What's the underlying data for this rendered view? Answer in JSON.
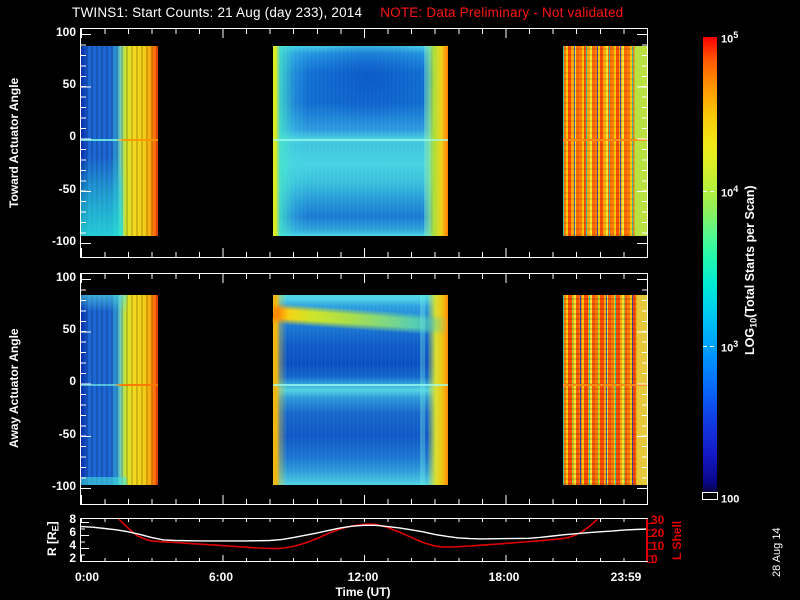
{
  "title": {
    "text": "TWINS1: Start Counts: 21 Aug (day 233), 2014",
    "note": "NOTE: Data Preliminary - Not validated"
  },
  "colors": {
    "note_red": "#ff1515",
    "axis_white": "#ffffff",
    "l_shell_red": "#e00000",
    "background": "#000000"
  },
  "panels": {
    "toward": {
      "ylabel": "Toward Actuator Angle",
      "yticks": [
        "100",
        "50",
        "0",
        "-50",
        "-100"
      ]
    },
    "away": {
      "ylabel": "Away Actuator Angle",
      "yticks": [
        "100",
        "50",
        "0",
        "-50",
        "-100"
      ]
    },
    "orbit": {
      "ylabel_left_pre": "R [R",
      "ylabel_left_sub": "E",
      "ylabel_left_post": "]",
      "left_ticks": [
        "8",
        "6",
        "4",
        "2"
      ],
      "ylabel_right": "L Shell",
      "right_ticks": [
        "30",
        "20",
        "10",
        "0"
      ]
    }
  },
  "xaxis": {
    "label": "Time (UT)",
    "ticks": [
      "0:00",
      "6:00",
      "12:00",
      "18:00",
      "23:59"
    ]
  },
  "colorbar": {
    "label_pre": "LOG",
    "label_sub": "10",
    "label_post": "(Total Starts per Scan)",
    "ticks": [
      {
        "b": "10",
        "s": "5"
      },
      {
        "b": "10",
        "s": "4"
      },
      {
        "b": "10",
        "s": "3"
      },
      {
        "b": "100",
        "s": ""
      }
    ]
  },
  "datestamp": "28 Aug 14",
  "chart_data": [
    {
      "type": "heatmap",
      "panel": "toward",
      "ylabel": "Toward Actuator Angle",
      "xlim_hours": [
        0,
        24
      ],
      "ylim": [
        -100,
        100
      ],
      "value_label": "LOG10(Total Starts per Scan)",
      "value_scale": "log",
      "value_range": [
        100,
        100000
      ],
      "segments": [
        {
          "start_hour": 0.0,
          "end_hour": 3.3,
          "description": "blue striated columns on left half, yellow-orange stripes on right half, cyan region below -40 deg on left, orange horizontal line at 0 deg"
        },
        {
          "start_hour": 8.1,
          "end_hour": 15.6,
          "description": "smooth blue field, darkest near top center, cyan lower half, thin bright cyan line at 0 deg, yellow-green then orange column at right edge, cyan-yellow sliver at left edge"
        },
        {
          "start_hour": 20.4,
          "end_hour": 24.0,
          "description": "noisy orange/red/yellow vertical stripes with scattered cyan and dark-blue pixels, smooth yellow-green band at far right, orange line at 0 deg"
        }
      ],
      "gaps_hours": [
        [
          3.3,
          8.1
        ],
        [
          15.6,
          20.4
        ]
      ]
    },
    {
      "type": "heatmap",
      "panel": "away",
      "ylabel": "Away Actuator Angle",
      "xlim_hours": [
        0,
        24
      ],
      "ylim": [
        -100,
        100
      ],
      "value_label": "LOG10(Total Starts per Scan)",
      "value_scale": "log",
      "value_range": [
        100,
        100000
      ],
      "segments": [
        {
          "start_hour": 0.0,
          "end_hour": 3.3,
          "description": "blue striated left half, yellow-orange right half, cyan band at top edge, orange horizontal line at 0 deg"
        },
        {
          "start_hour": 8.1,
          "end_hour": 15.6,
          "description": "bright yellow-orange arc near +75 deg (brightest at left, fading rightward to green then cyan, sloping slightly down), dark blue body, light cyan line at 0 deg, yellow columns at both edges"
        },
        {
          "start_hour": 20.4,
          "end_hour": 24.0,
          "description": "noisy orange/red/yellow vertical stripes with cyan, green and dark-blue speckles, smoother yellow band at right edge"
        }
      ],
      "gaps_hours": [
        [
          3.3,
          8.1
        ],
        [
          15.6,
          20.4
        ]
      ]
    },
    {
      "type": "line",
      "panel": "orbit",
      "x_unit": "hours UT",
      "series": [
        {
          "name": "R [RE]",
          "color": "#ffffff",
          "axis": "left",
          "ylim": [
            2,
            8
          ],
          "points": [
            [
              0,
              7.3
            ],
            [
              0.5,
              7.2
            ],
            [
              1,
              7.0
            ],
            [
              1.5,
              6.8
            ],
            [
              2,
              6.5
            ],
            [
              2.5,
              6.1
            ],
            [
              3,
              5.6
            ],
            [
              3.5,
              5.25
            ],
            [
              4,
              5.15
            ],
            [
              5,
              5.1
            ],
            [
              6,
              5.1
            ],
            [
              7,
              5.1
            ],
            [
              8,
              5.15
            ],
            [
              8.5,
              5.3
            ],
            [
              9,
              5.6
            ],
            [
              9.5,
              5.95
            ],
            [
              10,
              6.3
            ],
            [
              10.5,
              6.7
            ],
            [
              11,
              7.1
            ],
            [
              11.5,
              7.35
            ],
            [
              12,
              7.5
            ],
            [
              12.5,
              7.5
            ],
            [
              13,
              7.3
            ],
            [
              13.5,
              7.1
            ],
            [
              14,
              6.8
            ],
            [
              14.5,
              6.5
            ],
            [
              15,
              6.1
            ],
            [
              15.5,
              5.8
            ],
            [
              16,
              5.55
            ],
            [
              16.5,
              5.45
            ],
            [
              17,
              5.4
            ],
            [
              18,
              5.45
            ],
            [
              19,
              5.5
            ],
            [
              19.5,
              5.65
            ],
            [
              20,
              5.85
            ],
            [
              20.5,
              6.05
            ],
            [
              21,
              6.2
            ],
            [
              21.5,
              6.35
            ],
            [
              22,
              6.5
            ],
            [
              22.5,
              6.6
            ],
            [
              23,
              6.75
            ],
            [
              23.5,
              6.85
            ],
            [
              24,
              6.9
            ]
          ]
        },
        {
          "name": "L Shell",
          "color": "#e00000",
          "axis": "right",
          "ylim": [
            0,
            30
          ],
          "points": [
            [
              1.6,
              33
            ],
            [
              2,
              26
            ],
            [
              2.4,
              20
            ],
            [
              2.8,
              17
            ],
            [
              3,
              16.2
            ],
            [
              3.5,
              15.5
            ],
            [
              4,
              15
            ],
            [
              4.5,
              14.4
            ],
            [
              5,
              13.8
            ],
            [
              5.5,
              13.2
            ],
            [
              6,
              12.6
            ],
            [
              6.5,
              12
            ],
            [
              7,
              11.4
            ],
            [
              7.5,
              10.8
            ],
            [
              8,
              10.4
            ],
            [
              8.3,
              10.3
            ],
            [
              8.6,
              10.8
            ],
            [
              9,
              12
            ],
            [
              9.5,
              14.5
            ],
            [
              10,
              18
            ],
            [
              10.5,
              22
            ],
            [
              11,
              25.5
            ],
            [
              11.5,
              27.8
            ],
            [
              12,
              29
            ],
            [
              12.3,
              29.2
            ],
            [
              12.6,
              28.5
            ],
            [
              13,
              26.5
            ],
            [
              13.5,
              23
            ],
            [
              14,
              19
            ],
            [
              14.5,
              15
            ],
            [
              15,
              12.3
            ],
            [
              15.3,
              11.6
            ],
            [
              15.6,
              11.5
            ],
            [
              16,
              11.8
            ],
            [
              16.5,
              12.3
            ],
            [
              17,
              13
            ],
            [
              17.5,
              13.6
            ],
            [
              18,
              14.3
            ],
            [
              18.5,
              15
            ],
            [
              19,
              15.7
            ],
            [
              19.5,
              16.4
            ],
            [
              20,
              17.2
            ],
            [
              20.4,
              18
            ],
            [
              20.7,
              19
            ],
            [
              21,
              21
            ],
            [
              21.3,
              24
            ],
            [
              21.6,
              28
            ],
            [
              21.9,
              33
            ]
          ]
        }
      ]
    }
  ]
}
